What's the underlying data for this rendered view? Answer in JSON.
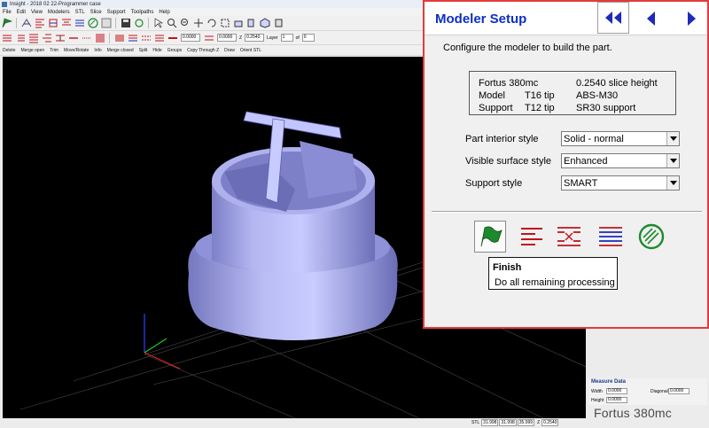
{
  "app": {
    "title": "Insight - 2018 02 22-Programmer case",
    "menus": [
      "File",
      "Edit",
      "View",
      "Modelers",
      "STL",
      "Slice",
      "Support",
      "Toolpaths",
      "Help"
    ]
  },
  "toolbar2": {
    "field1": "0.0000",
    "field2": "0.0000",
    "z_label": "Z",
    "z_value": "0.2540",
    "layer_label": "Layer",
    "layer_value": "1",
    "of_label": "of",
    "of_value": "0"
  },
  "toolbar3": {
    "commands": [
      "Delete",
      "Merge open",
      "Trim",
      "Move/Rotate",
      "Info",
      "Merge closed",
      "Split",
      "Hide",
      "Groups",
      "Copy Through Z",
      "Draw",
      "Orient STL"
    ]
  },
  "status": {
    "label": "STL",
    "x": "31.998",
    "y": "31.998",
    "z_label": "Z",
    "z": "0.2540",
    "extra": "35.999"
  },
  "measure": {
    "title": "Measure Data",
    "width_label": "Width",
    "width_value": "0.0000",
    "height_label": "Height",
    "height_value": "0.0000",
    "diagonal_label": "Diagonal",
    "diagonal_value": "0.0000"
  },
  "brand": {
    "text": "Fortus 380mc"
  },
  "dialog": {
    "title": "Modeler Setup",
    "instructions": "Configure the modeler to build the part.",
    "summary": {
      "modeler": "Fortus 380mc",
      "slice_height": "0.2540 slice height",
      "model_label": "Model",
      "model_tip": "T16 tip",
      "model_material": "ABS-M30",
      "support_label": "Support",
      "support_tip": "T12 tip",
      "support_material": "SR30 support"
    },
    "fields": [
      {
        "label": "Part interior style",
        "value": "Solid - normal"
      },
      {
        "label": "Visible surface style",
        "value": "Enhanced"
      },
      {
        "label": "Support style",
        "value": "SMART"
      }
    ],
    "tooltip": {
      "title": "Finish",
      "body": "Do all remaining processing"
    },
    "colors": {
      "title": "#0d2fc4",
      "border": "#e23b3b",
      "icon_red": "#c0141c",
      "icon_blue": "#1e2ab8",
      "icon_green": "#1c8a2c"
    }
  }
}
